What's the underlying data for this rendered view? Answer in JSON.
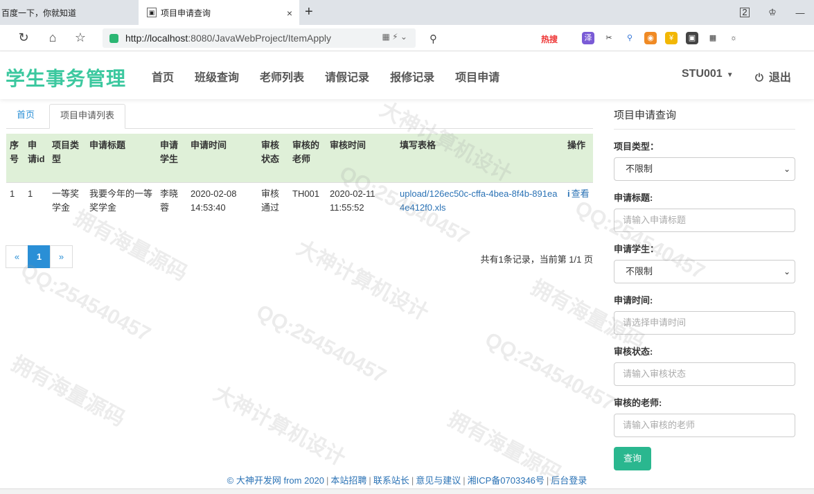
{
  "browser": {
    "tabs": [
      {
        "title": "百度一下，你就知道"
      },
      {
        "title": "项目申请查询",
        "close": "×"
      }
    ],
    "new_tab": "+",
    "tab_count": "2",
    "url_host": "http://localhost",
    "url_rest": ":8080/JavaWebProject/ItemApply",
    "search_hot": "热搜",
    "window_controls": [
      "—"
    ]
  },
  "site": {
    "brand": "学生事务管理",
    "nav": [
      "首页",
      "班级查询",
      "老师列表",
      "请假记录",
      "报修记录",
      "项目申请"
    ],
    "user": "STU001",
    "logout": "退出"
  },
  "breadcrumb": {
    "home": "首页",
    "current": "项目申请列表"
  },
  "table": {
    "headers": [
      "序号",
      "申请id",
      "项目类型",
      "申请标题",
      "申请学生",
      "申请时间",
      "审核状态",
      "审核的老师",
      "审核时间",
      "填写表格",
      "操作"
    ],
    "rows": [
      {
        "seq": "1",
        "id": "1",
        "type": "一等奖学金",
        "title": "我要今年的一等奖学金",
        "student": "李晓蓉",
        "apply_time": "2020-02-08 14:53:40",
        "status": "审核通过",
        "teacher": "TH001",
        "review_time": "2020-02-11 11:55:52",
        "file": "upload/126ec50c-cffa-4bea-8f4b-891ea4e412f0.xls",
        "action": "查看"
      }
    ]
  },
  "pagination": {
    "prev": "«",
    "current": "1",
    "next": "»",
    "summary": "共有1条记录，当前第 1/1 页"
  },
  "sidebar": {
    "title": "项目申请查询",
    "fields": [
      {
        "label": "项目类型：",
        "type": "select",
        "value": "不限制"
      },
      {
        "label": "申请标题:",
        "type": "input",
        "placeholder": "请输入申请标题"
      },
      {
        "label": "申请学生：",
        "type": "select",
        "value": "不限制"
      },
      {
        "label": "申请时间:",
        "type": "input",
        "placeholder": "请选择申请时间"
      },
      {
        "label": "审核状态:",
        "type": "input",
        "placeholder": "请输入审核状态"
      },
      {
        "label": "审核的老师:",
        "type": "input",
        "placeholder": "请输入审核的老师"
      }
    ],
    "query_button": "查询"
  },
  "footer": {
    "copyright": "© 大神开发网 from 2020",
    "links": [
      "本站招聘",
      "联系站长",
      "意见与建议",
      "湘ICP备0703346号",
      "后台登录"
    ]
  },
  "watermarks": [
    "QQ:254540457",
    "大神计算机设计",
    "拥有海量源码"
  ],
  "colors": {
    "brand": "#3cc89f",
    "table_header_bg": "#dff0d8",
    "link": "#2a72b5",
    "pager_active": "#2a8fd6",
    "query_button": "#2ab78f"
  }
}
